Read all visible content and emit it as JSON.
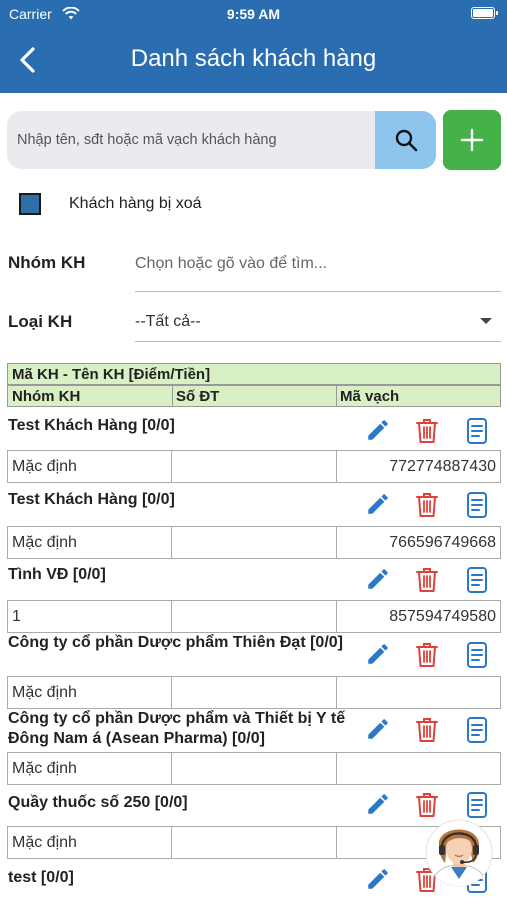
{
  "status_bar": {
    "carrier": "Carrier",
    "time": "9:59 AM"
  },
  "header": {
    "title": "Danh sách khách hàng"
  },
  "search": {
    "placeholder": "Nhập tên, sđt hoặc mã vạch khách hàng"
  },
  "filters": {
    "deleted_label": "Khách hàng bị xoá",
    "deleted_checked": true,
    "group_label": "Nhóm KH",
    "group_placeholder": "Chọn hoặc gõ vào để tìm...",
    "type_label": "Loại KH",
    "type_value": "--Tất cả--"
  },
  "table": {
    "header_row1": "Mã KH - Tên KH [Điểm/Tiền]",
    "col_group": "Nhóm KH",
    "col_phone": "Số ĐT",
    "col_barcode": "Mã vạch"
  },
  "customers": [
    {
      "name": "Test Khách Hàng [0/0]",
      "group": "Mặc định",
      "phone": "",
      "barcode": "772774887430"
    },
    {
      "name": "Test Khách Hàng [0/0]",
      "group": "Mặc định",
      "phone": "",
      "barcode": "766596749668"
    },
    {
      "name": "Tình VĐ [0/0]",
      "group": "1",
      "phone": "",
      "barcode": "857594749580"
    },
    {
      "name": "Công ty cổ phần Dược phẩm Thiên Đạt [0/0]",
      "group": "Mặc định",
      "phone": "",
      "barcode": ""
    },
    {
      "name": "Công ty cổ phần Dược phẩm và Thiết bị Y tế Đông Nam á (Asean Pharma) [0/0]",
      "group": "Mặc định",
      "phone": "",
      "barcode": ""
    },
    {
      "name": "Quầy thuốc số 250 [0/0]",
      "group": "Mặc định",
      "phone": "",
      "barcode": ""
    },
    {
      "name": "test [0/0]",
      "group": "",
      "phone": "",
      "barcode": ""
    }
  ],
  "colors": {
    "header_bg": "#2a6db0",
    "add_button": "#45b149",
    "search_button": "#8ec5ef",
    "edit_icon": "#2a78c8",
    "delete_icon": "#e0413a",
    "table_header": "#d8f0c4"
  },
  "icons": {
    "back": "chevron-left-icon",
    "search": "search-icon",
    "add": "plus-icon",
    "edit": "pencil-icon",
    "delete": "trash-icon",
    "detail": "document-icon",
    "support": "customer-support-avatar"
  }
}
